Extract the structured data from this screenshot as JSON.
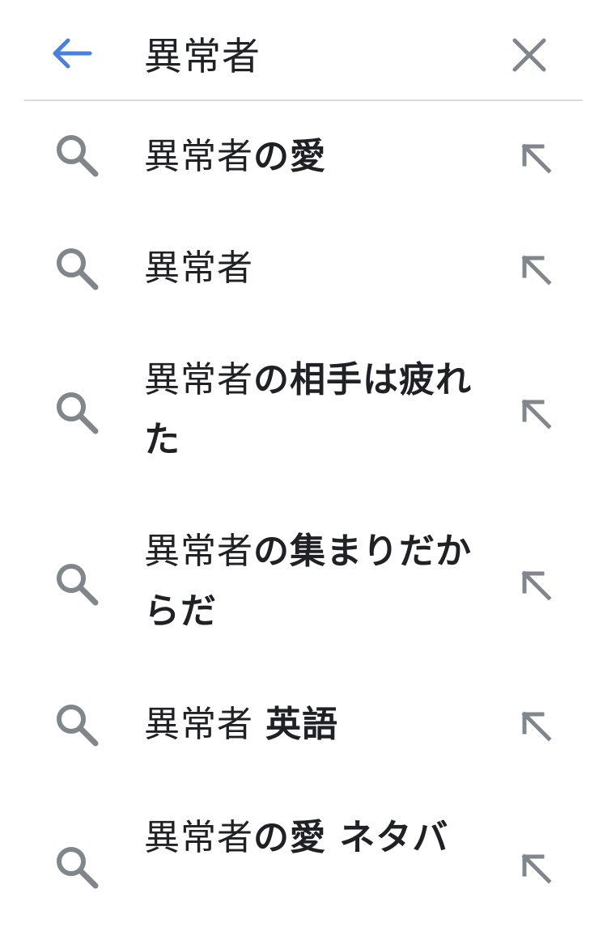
{
  "search": {
    "query": "異常者",
    "back_icon": "arrow-left-icon",
    "clear_icon": "close-icon",
    "accent_color": "#4a7fdc"
  },
  "suggestions": [
    {
      "match": "異常者",
      "completion": "の愛"
    },
    {
      "match": "異常者",
      "completion": ""
    },
    {
      "match": "異常者",
      "completion": "の相手は疲れた"
    },
    {
      "match": "異常者",
      "completion": "の集まりだからだ"
    },
    {
      "match": "異常者 ",
      "completion": "英語"
    },
    {
      "match": "異常者",
      "completion": "の愛 ネタバ"
    }
  ],
  "icons": {
    "suggestion_icon": "search-icon",
    "fill_icon": "arrow-up-left-icon",
    "icon_color": "#80868b"
  }
}
